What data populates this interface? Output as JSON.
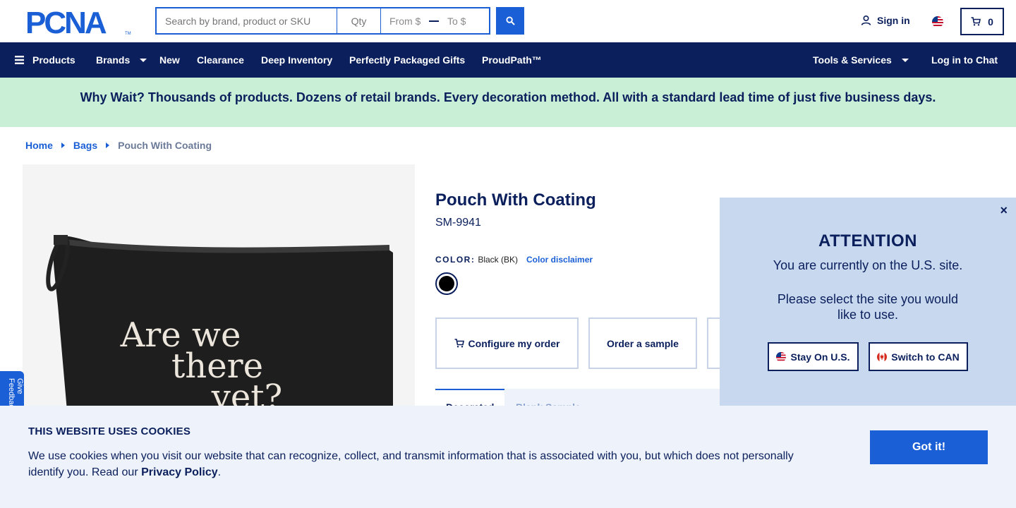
{
  "brand": {
    "logo_text": "PCNA"
  },
  "header": {
    "search_placeholder": "Search by brand, product or SKU",
    "qty_placeholder": "Qty",
    "price_from": "From $",
    "price_to": "To $",
    "sign_in": "Sign in",
    "cart_count": "0"
  },
  "nav": {
    "products": "Products",
    "brands": "Brands",
    "new": "New",
    "clearance": "Clearance",
    "deep_inventory": "Deep Inventory",
    "gifts": "Perfectly Packaged Gifts",
    "proudpath": "ProudPath™",
    "tools": "Tools & Services",
    "chat": "Log in to Chat"
  },
  "promo": "Why Wait? Thousands of products. Dozens of retail brands. Every decoration method. All with a standard lead time of just five business days.",
  "breadcrumb": {
    "home": "Home",
    "bags": "Bags",
    "current": "Pouch With Coating"
  },
  "product": {
    "title": "Pouch With Coating",
    "sku": "SM-9941",
    "color_label": "COLOR:",
    "color_value": "Black (BK)",
    "color_disclaimer": "Color disclaimer",
    "image_text": [
      "Are we",
      "there",
      "yet?"
    ],
    "configure": "Configure my order",
    "sample": "Order a sample",
    "tab_active": "Decorated",
    "tab_other": "Blank",
    "tab_other_extra": "Sample"
  },
  "attention": {
    "title": "ATTENTION",
    "current": "You are currently on the U.S. site.",
    "prompt": "Please select the site you would like to use.",
    "stay": "Stay On U.S.",
    "switch": "Switch to CAN",
    "close": "×"
  },
  "feedback": "Give Feedback",
  "cookie": {
    "title": "THIS WEBSITE USES COOKIES",
    "body": "We use cookies when you visit our website that can recognize, collect, and transmit information that is associated with you, but which does not personally identify you. Read our ",
    "link": "Privacy Policy",
    "end": ".",
    "button": "Got it!"
  }
}
